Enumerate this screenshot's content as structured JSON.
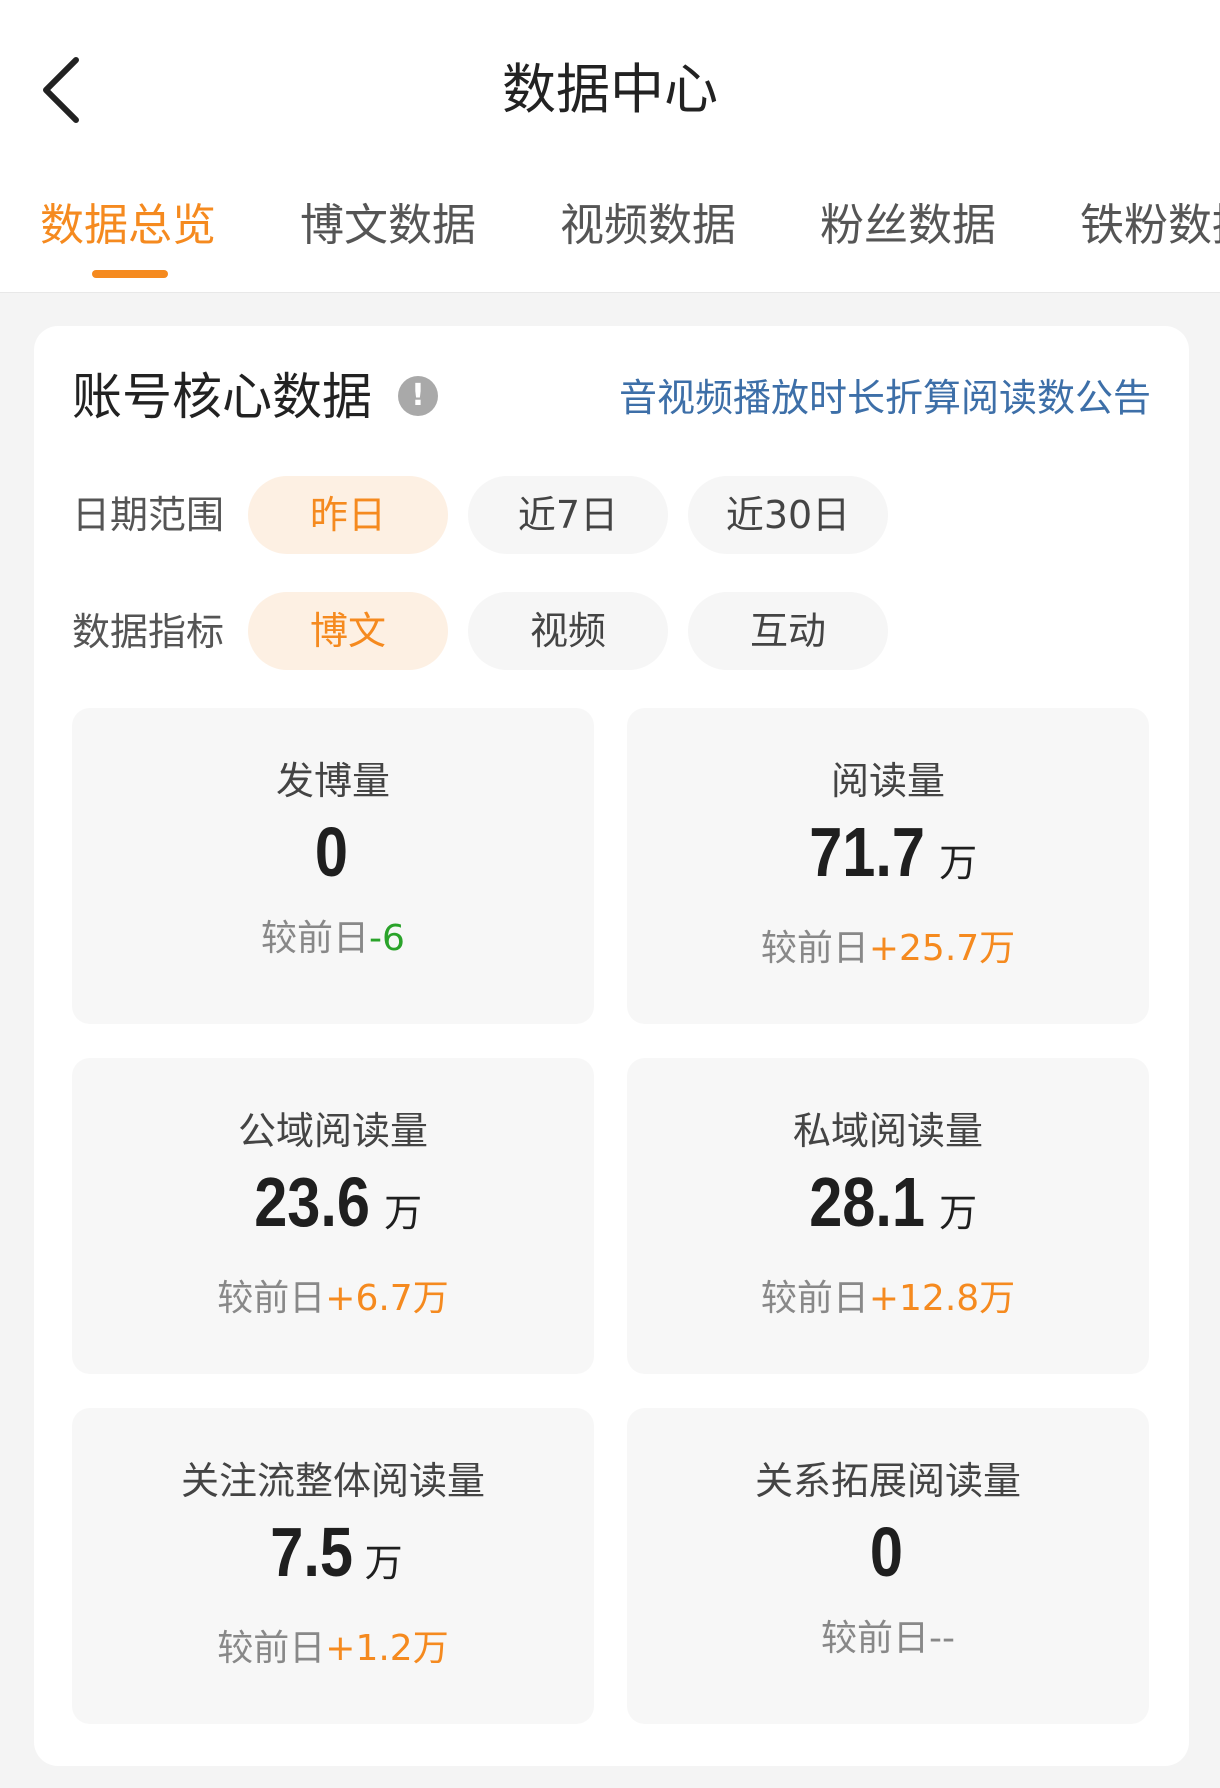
{
  "header": {
    "title": "数据中心"
  },
  "tabs": [
    {
      "label": "数据总览",
      "active": true
    },
    {
      "label": "博文数据",
      "active": false
    },
    {
      "label": "视频数据",
      "active": false
    },
    {
      "label": "粉丝数据",
      "active": false
    },
    {
      "label": "铁粉数据",
      "active": false
    }
  ],
  "core": {
    "title": "账号核心数据",
    "info_icon_text": "!",
    "notice_link": "音视频播放时长折算阅读数公告",
    "date_range": {
      "label": "日期范围",
      "options": [
        "昨日",
        "近7日",
        "近30日"
      ],
      "selected": "昨日"
    },
    "metric_type": {
      "label": "数据指标",
      "options": [
        "博文",
        "视频",
        "互动"
      ],
      "selected": "博文"
    }
  },
  "compare_prefix": "较前日",
  "metrics": [
    {
      "label": "发博量",
      "value": "0",
      "unit": "",
      "delta": "-6",
      "delta_dir": "down"
    },
    {
      "label": "阅读量",
      "value": "71.7",
      "unit": "万",
      "delta": "+25.7万",
      "delta_dir": "up"
    },
    {
      "label": "公域阅读量",
      "value": "23.6",
      "unit": "万",
      "delta": "+6.7万",
      "delta_dir": "up"
    },
    {
      "label": "私域阅读量",
      "value": "28.1",
      "unit": "万",
      "delta": "+12.8万",
      "delta_dir": "up"
    },
    {
      "label": "关注流整体阅读量",
      "value": "7.5",
      "unit": "万",
      "delta": "+1.2万",
      "delta_dir": "up"
    },
    {
      "label": "关系拓展阅读量",
      "value": "0",
      "unit": "",
      "delta": "--",
      "delta_dir": "none"
    }
  ],
  "colors": {
    "accent": "#f58a1f",
    "negative": "#2aa32a",
    "link": "#3d6fa8"
  }
}
